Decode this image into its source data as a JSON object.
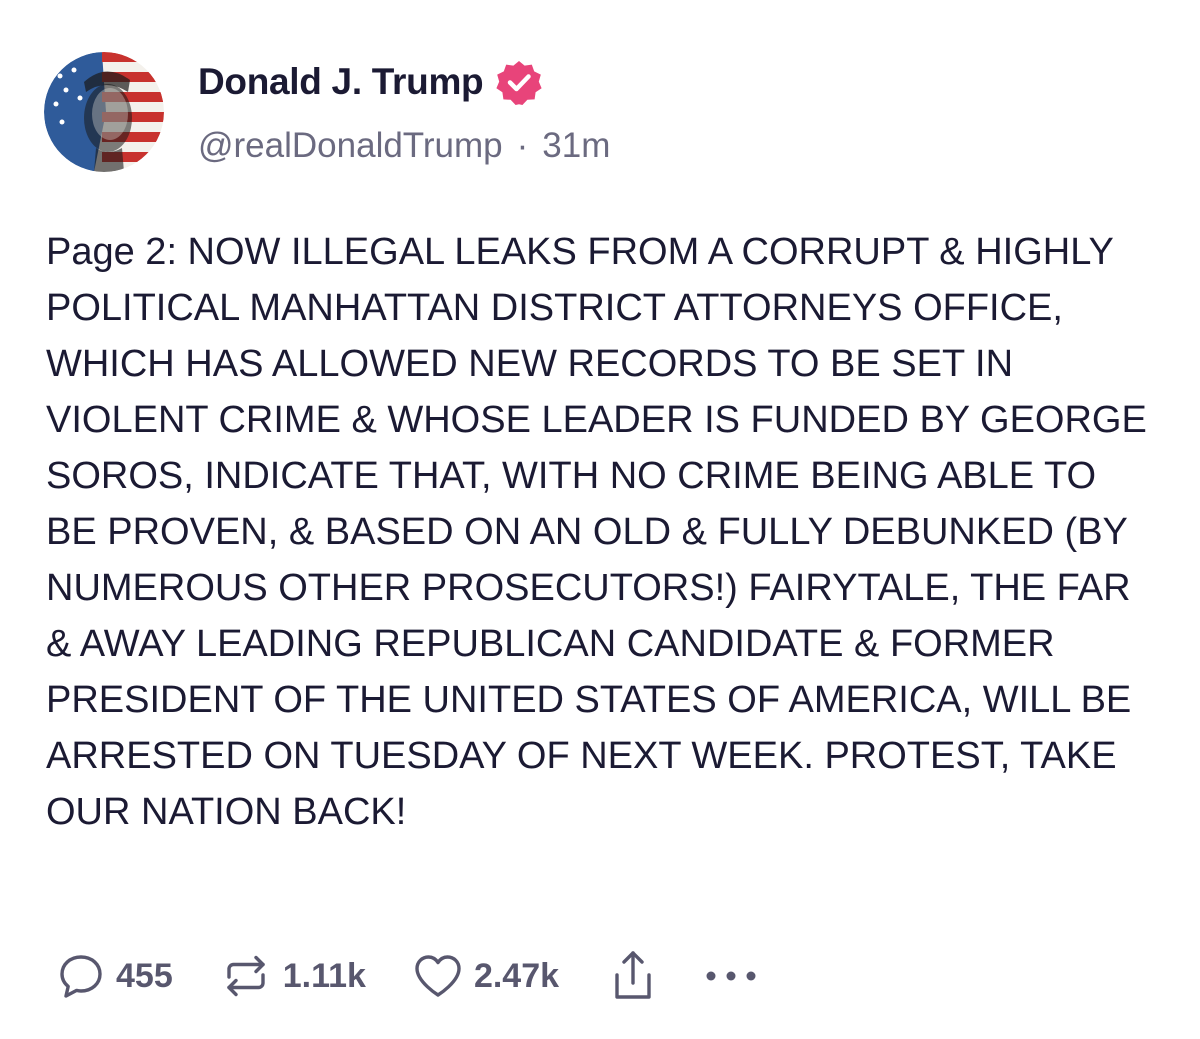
{
  "author": {
    "display_name": "Donald J. Trump",
    "handle": "@realDonaldTrump",
    "separator": "·",
    "timestamp": "31m",
    "verified": true,
    "verified_color": "#e8447a"
  },
  "post": {
    "text": "Page 2: NOW ILLEGAL LEAKS FROM A CORRUPT & HIGHLY POLITICAL MANHATTAN DISTRICT ATTORNEYS OFFICE, WHICH HAS ALLOWED NEW RECORDS TO BE SET IN VIOLENT CRIME & WHOSE LEADER IS FUNDED BY GEORGE SOROS, INDICATE THAT, WITH NO CRIME BEING ABLE TO BE PROVEN, & BASED ON AN OLD & FULLY DEBUNKED (BY NUMEROUS OTHER PROSECUTORS!) FAIRYTALE, THE FAR & AWAY LEADING REPUBLICAN CANDIDATE & FORMER PRESIDENT OF THE UNITED STATES OF AMERICA, WILL BE ARRESTED ON TUESDAY OF NEXT WEEK. PROTEST, TAKE OUR NATION BACK!"
  },
  "actions": {
    "replies": {
      "icon": "reply-icon",
      "count": "455"
    },
    "reposts": {
      "icon": "repost-icon",
      "count": "1.11k"
    },
    "likes": {
      "icon": "heart-icon",
      "count": "2.47k"
    },
    "share": {
      "icon": "share-icon"
    },
    "more": {
      "icon": "more-icon"
    }
  },
  "colors": {
    "text": "#1b1a33",
    "muted": "#6b6a80",
    "action": "#58576e",
    "verified": "#e8447a"
  }
}
